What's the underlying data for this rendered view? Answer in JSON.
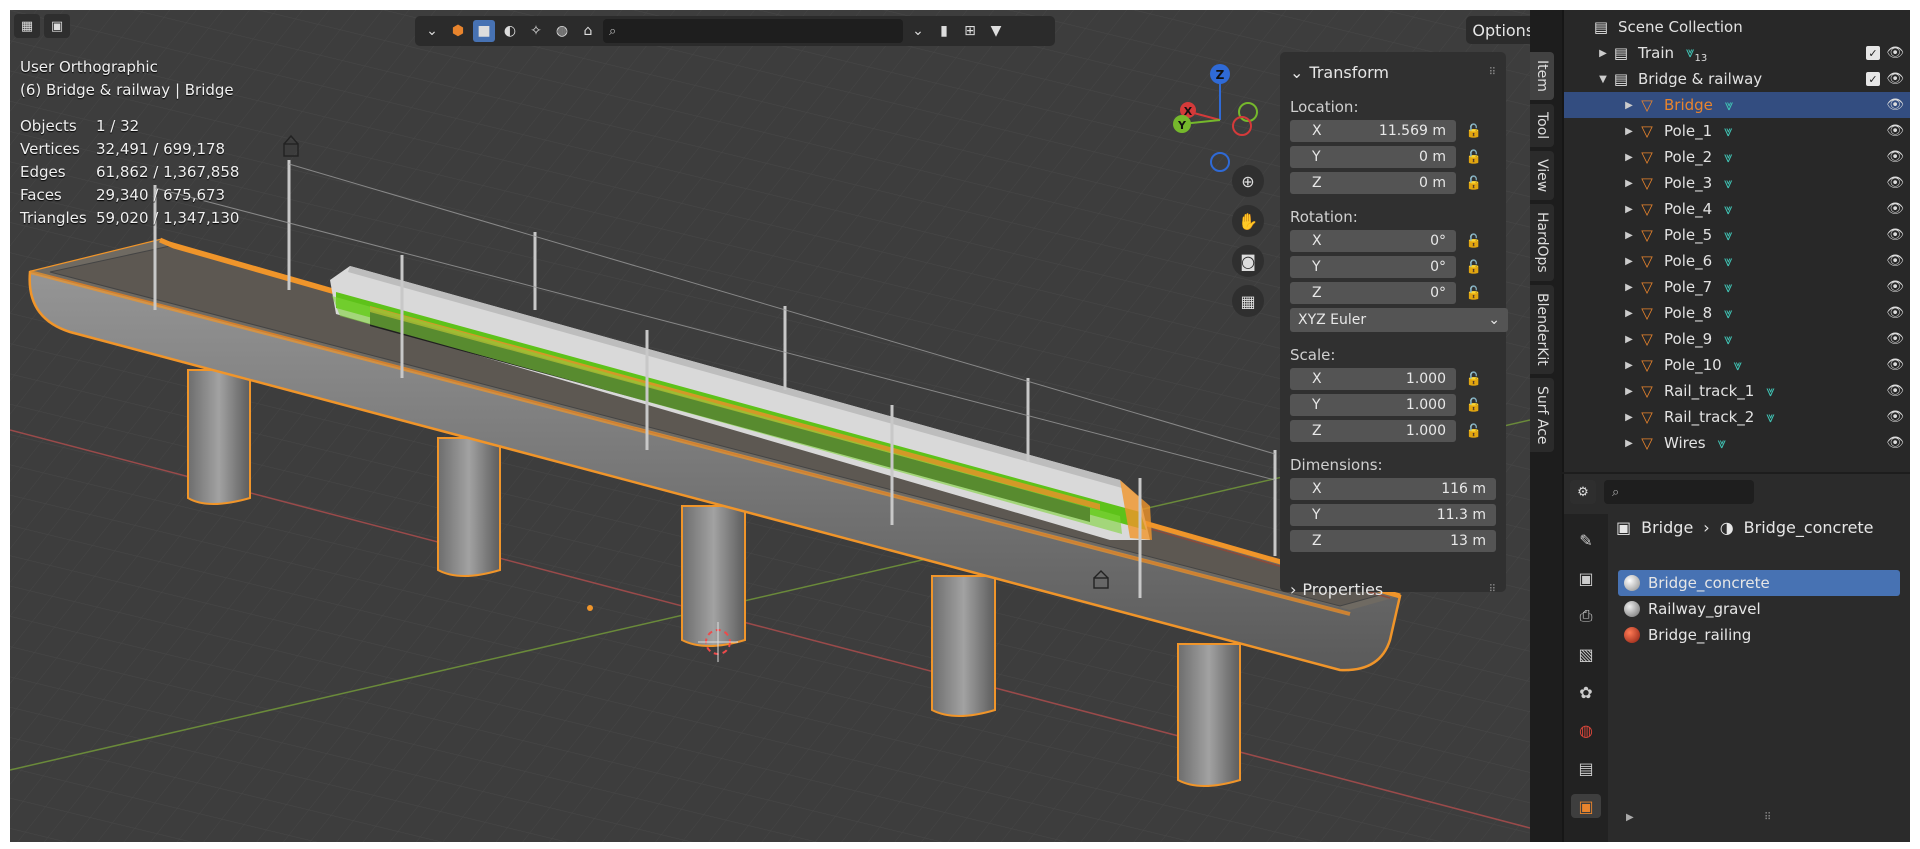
{
  "viewport": {
    "view_name": "User Orthographic",
    "context": "(6) Bridge & railway | Bridge",
    "stats": [
      {
        "label": "Objects",
        "value": "1 / 32"
      },
      {
        "label": "Vertices",
        "value": "32,491 / 699,178"
      },
      {
        "label": "Edges",
        "value": "61,862 / 1,367,858"
      },
      {
        "label": "Faces",
        "value": "29,340 / 675,673"
      },
      {
        "label": "Triangles",
        "value": "59,020 / 1,347,130"
      }
    ],
    "options_label": "Options",
    "gizmo": {
      "z": "Z",
      "x": "X",
      "y": "Y"
    }
  },
  "transform": {
    "title": "Transform",
    "location_label": "Location:",
    "location": [
      {
        "axis": "X",
        "value": "11.569 m"
      },
      {
        "axis": "Y",
        "value": "0 m"
      },
      {
        "axis": "Z",
        "value": "0 m"
      }
    ],
    "rotation_label": "Rotation:",
    "rotation": [
      {
        "axis": "X",
        "value": "0°"
      },
      {
        "axis": "Y",
        "value": "0°"
      },
      {
        "axis": "Z",
        "value": "0°"
      }
    ],
    "rotation_mode": "XYZ Euler",
    "scale_label": "Scale:",
    "scale": [
      {
        "axis": "X",
        "value": "1.000"
      },
      {
        "axis": "Y",
        "value": "1.000"
      },
      {
        "axis": "Z",
        "value": "1.000"
      }
    ],
    "dimensions_label": "Dimensions:",
    "dimensions": [
      {
        "axis": "X",
        "value": "116 m"
      },
      {
        "axis": "Y",
        "value": "11.3 m"
      },
      {
        "axis": "Z",
        "value": "13 m"
      }
    ],
    "properties_label": "Properties"
  },
  "side_tabs": [
    "Item",
    "Tool",
    "View",
    "HardOps",
    "BlenderKit",
    "Surf Ace"
  ],
  "outliner": {
    "root": "Scene Collection",
    "train": {
      "name": "Train",
      "badge": "13"
    },
    "collection": "Bridge & railway",
    "objects": [
      "Bridge",
      "Pole_1",
      "Pole_2",
      "Pole_3",
      "Pole_4",
      "Pole_5",
      "Pole_6",
      "Pole_7",
      "Pole_8",
      "Pole_9",
      "Pole_10",
      "Rail_track_1",
      "Rail_track_2",
      "Wires"
    ]
  },
  "properties": {
    "object": "Bridge",
    "material": "Bridge_concrete",
    "materials": [
      {
        "name": "Bridge_concrete",
        "color": "#d8d8d8"
      },
      {
        "name": "Railway_gravel",
        "color": "#bcbcbc"
      },
      {
        "name": "Bridge_railing",
        "color": "#c0341c"
      }
    ]
  },
  "colors": {
    "selection_outline": "#f0952a",
    "accent": "#4772b3",
    "train_green": "#5ec21a"
  }
}
